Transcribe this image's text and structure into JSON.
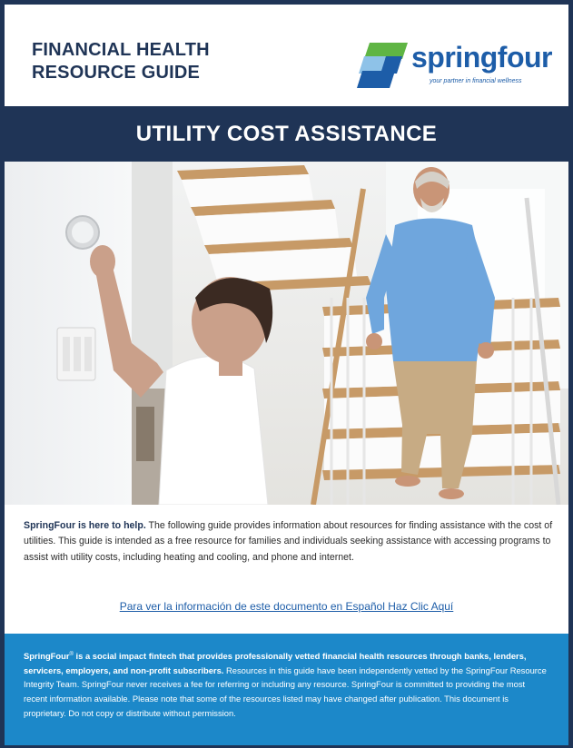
{
  "header": {
    "title_line1": "FINANCIAL HEALTH",
    "title_line2": "RESOURCE GUIDE",
    "logo_name": "springfour",
    "logo_tagline": "your partner in financial wellness"
  },
  "banner": {
    "title": "UTILITY COST ASSISTANCE"
  },
  "intro": {
    "lead": "SpringFour is here to help.",
    "body": " The following guide provides information about resources for finding assistance with the cost of utilities. This guide is intended as a free resource for families and individuals seeking assistance with accessing programs to assist with utility costs, including heating and cooling, and phone and internet."
  },
  "spanish_link": "Para ver la información de este documento en Español Haz Clic Aquí",
  "about": {
    "brand": "SpringFour",
    "reg_mark": "®",
    "bold_text": " is a social impact fintech that provides professionally vetted financial health resources through banks, lenders, servicers, employers, and non-profit subscribers.",
    "body": " Resources in this guide have been independently vetted by the SpringFour Resource Integrity Team. SpringFour never receives a fee for referring or including any resource. SpringFour is committed to providing the most recent information available. Please note that some of the resources listed may have changed after publication. This document is proprietary. Do not copy or distribute without permission."
  },
  "colors": {
    "navy": "#1f3456",
    "brand_blue": "#1d5da8",
    "footer_blue": "#1c88c9",
    "logo_green": "#5fb544",
    "logo_light_blue": "#8ec2e8"
  },
  "icons": [
    "springfour-logo-mark",
    "thermostat",
    "photo-boy-thermostat-man-stairs"
  ]
}
